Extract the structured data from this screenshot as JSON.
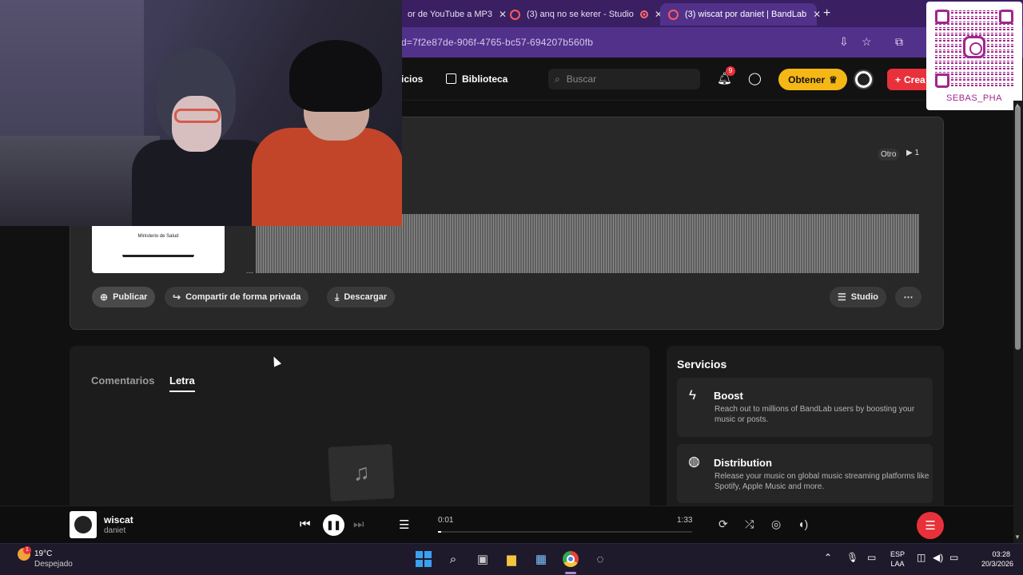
{
  "browser": {
    "tabs": [
      {
        "title": "or de YouTube a MP3"
      },
      {
        "title": "(3) anq no se kerer - Studio"
      },
      {
        "title": "(3) wiscat por daniet | BandLab"
      }
    ],
    "url": "d=7f2e87de-906f-4765-bc57-694207b560fb"
  },
  "header": {
    "nav_partial": "icios",
    "library": "Biblioteca",
    "search_placeholder": "Buscar",
    "notif_count": "9",
    "get_label": "Obtener",
    "create_label": "Crea"
  },
  "track": {
    "genre": "Otro",
    "plays": "1",
    "cover_text": "Ministerio de Salud",
    "actions": {
      "publish": "Publicar",
      "share_private": "Compartir de forma privada",
      "download": "Descargar",
      "studio": "Studio"
    }
  },
  "overlay": {
    "qr_label": "SEBAS_PHA"
  },
  "content": {
    "tabs": [
      "Comentarios",
      "Letra"
    ],
    "active_tab": "Letra"
  },
  "services": {
    "title": "Servicios",
    "items": [
      {
        "title": "Boost",
        "description": "Reach out to millions of BandLab users by boosting your music or posts.",
        "icon": "lightning-icon"
      },
      {
        "title": "Distribution",
        "description": "Release your music on global music streaming platforms like Spotify, Apple Music and more.",
        "icon": "globe-music-icon"
      }
    ]
  },
  "player": {
    "title": "wiscat",
    "artist": "daniet",
    "elapsed": "0:01",
    "duration": "1:33",
    "progress_fraction": 0.011
  },
  "taskbar": {
    "weather_badge": "1",
    "temperature": "19°C",
    "weather": "Despejado",
    "lang_top": "ESP",
    "lang_bottom": "LAA",
    "time": "03:28",
    "date": "20/3/2026"
  },
  "colors": {
    "accent": "#e8313a",
    "gold": "#f5b715",
    "browser": "#51318a"
  }
}
